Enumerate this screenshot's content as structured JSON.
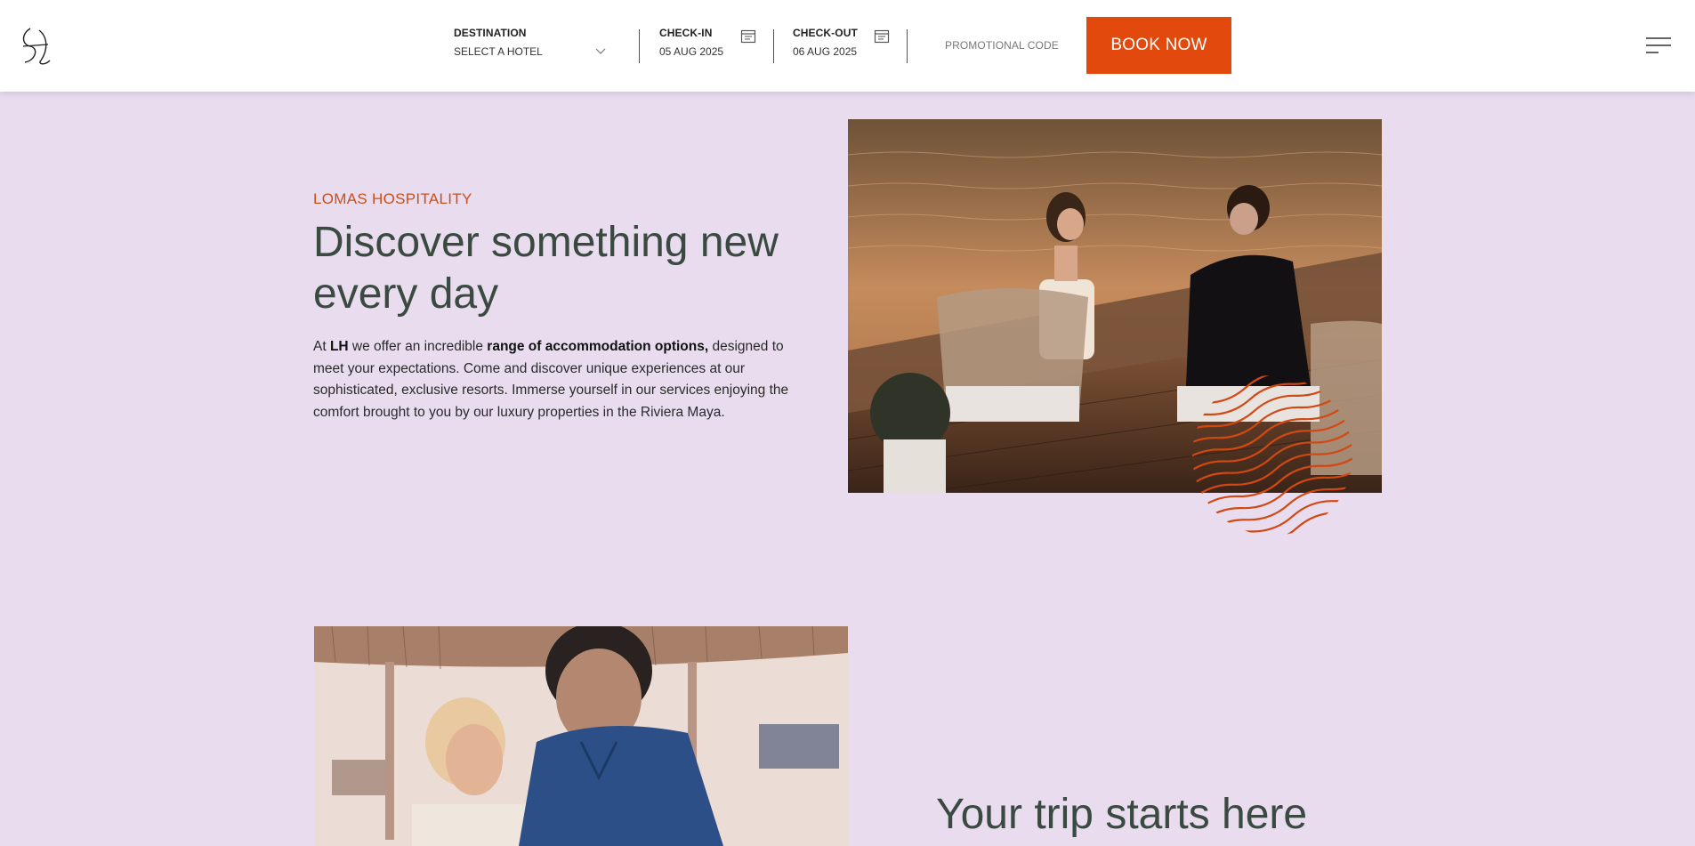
{
  "header": {
    "destination": {
      "label": "DESTINATION",
      "value": "SELECT A HOTEL"
    },
    "checkin": {
      "label": "CHECK-IN",
      "value": "05  AUG 2025"
    },
    "checkout": {
      "label": "CHECK-OUT",
      "value": "06  AUG 2025"
    },
    "promo_placeholder": "PROMOTIONAL CODE",
    "book_label": "BOOK NOW",
    "icons": {
      "logo": "lh-monogram",
      "calendar": "calendar-icon",
      "chevron": "chevron-down-icon",
      "menu": "hamburger-menu-icon"
    }
  },
  "intro": {
    "eyebrow": "LOMAS HOSPITALITY",
    "headline": "Discover something new every day",
    "body": {
      "p1": "At ",
      "b1": "LH",
      "p2": " we offer an incredible ",
      "b2": "range of accommodation options,",
      "p3": " designed to meet your expectations. Come and discover unique experiences at our sophisticated, exclusive resorts. Immerse yourself in our services enjoying the comfort brought to you by our luxury properties in the Riviera Maya."
    }
  },
  "trip": {
    "title": "Your trip starts here"
  },
  "colors": {
    "background": "#e8dcee",
    "accent": "#e24a0d",
    "headline": "#3a4a40",
    "eyebrow": "#c8501c"
  }
}
